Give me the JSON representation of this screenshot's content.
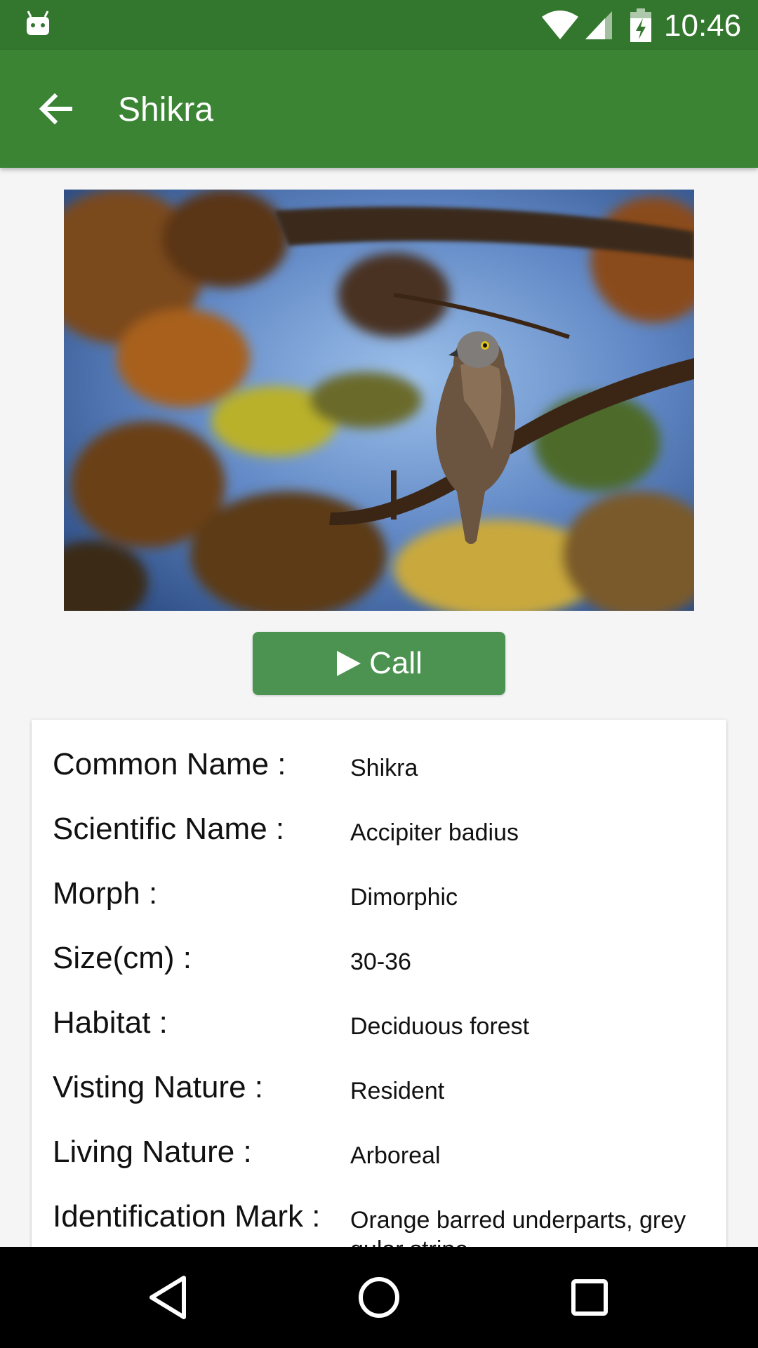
{
  "status_bar": {
    "time": "10:46",
    "icons": [
      "android-icon",
      "wifi-icon",
      "signal-icon",
      "battery-charging-icon"
    ]
  },
  "app_bar": {
    "title": "Shikra",
    "back_icon": "arrow-back-icon"
  },
  "call_button": {
    "label": "Call",
    "icon": "play-icon"
  },
  "details": [
    {
      "label": "Common Name :",
      "value": "Shikra"
    },
    {
      "label": "Scientific Name :",
      "value": "Accipiter badius"
    },
    {
      "label": "Morph :",
      "value": "Dimorphic"
    },
    {
      "label": "Size(cm) :",
      "value": "30-36"
    },
    {
      "label": "Habitat :",
      "value": "Deciduous forest"
    },
    {
      "label": "Visting Nature :",
      "value": "Resident"
    },
    {
      "label": "Living Nature :",
      "value": "Arboreal"
    },
    {
      "label": "Identification Mark :",
      "value": "Orange barred underparts, grey gular stripe"
    }
  ],
  "nav_bar": {
    "icons": [
      "back-triangle-icon",
      "home-circle-icon",
      "recents-square-icon"
    ]
  },
  "colors": {
    "status_bar": "#33772e",
    "app_bar": "#3a8434",
    "call_button": "#4c9351"
  }
}
